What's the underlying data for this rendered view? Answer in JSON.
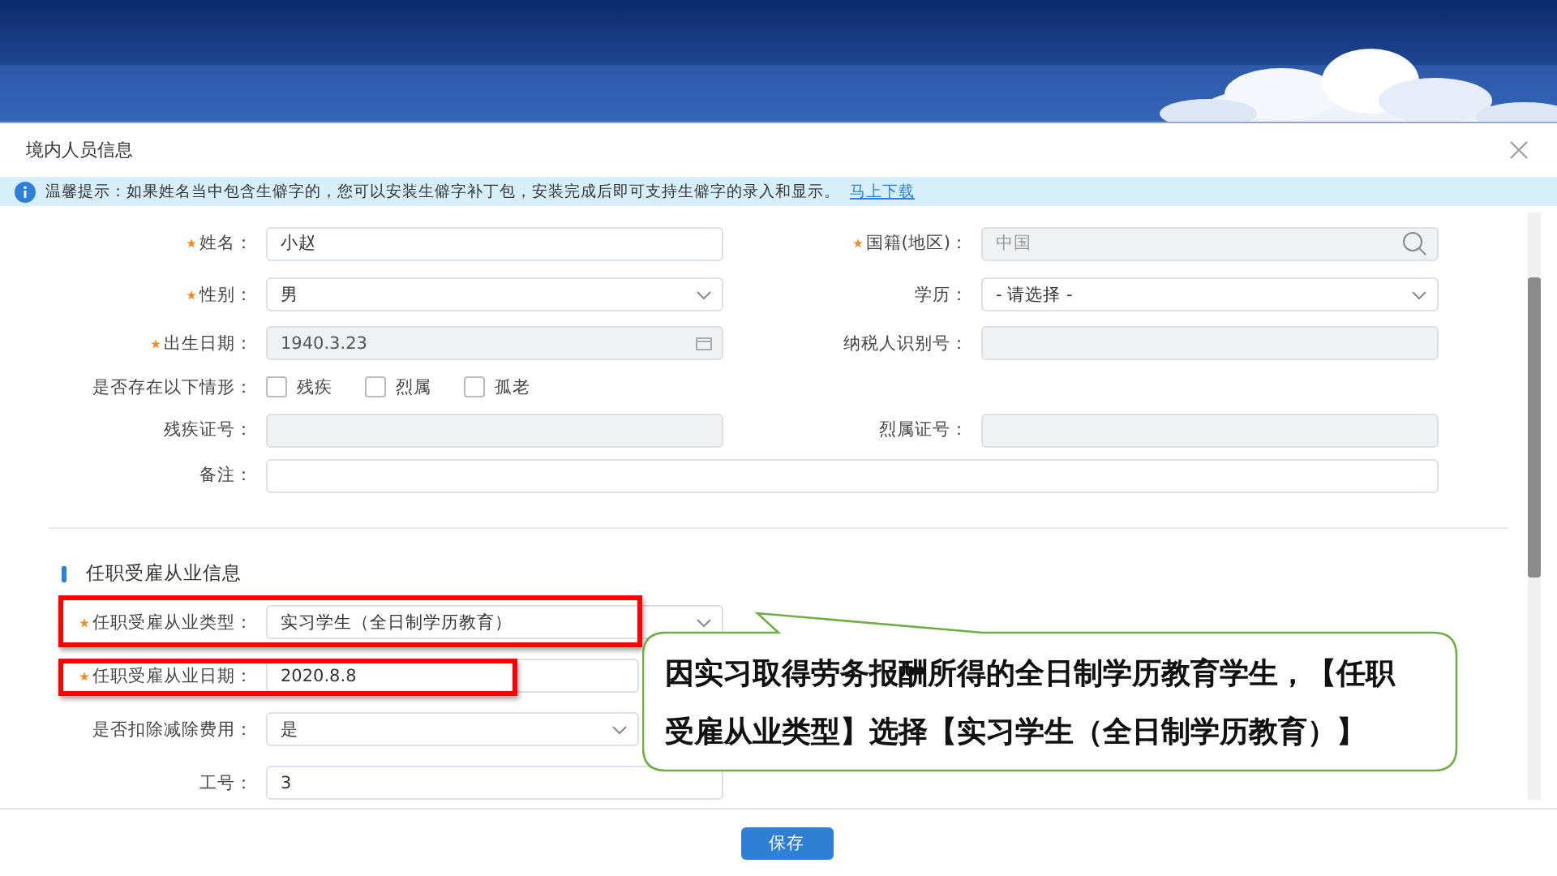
{
  "dialog": {
    "title": "境内人员信息"
  },
  "notice": {
    "text": "温馨提示：如果姓名当中包含生僻字的，您可以安装生僻字补丁包，安装完成后即可支持生僻字的录入和显示。",
    "link": "马上下载"
  },
  "personal_rows": [
    {
      "cells": [
        {
          "label": "姓名：",
          "required": true,
          "kind": "text",
          "value": "小赵",
          "disabled": false
        },
        {
          "label": "国籍(地区)：",
          "required": true,
          "kind": "search",
          "value": "中国",
          "disabled": true
        }
      ]
    },
    {
      "cells": [
        {
          "label": "性别：",
          "required": true,
          "kind": "select",
          "value": "男",
          "disabled": false
        },
        {
          "label": "学历：",
          "required": false,
          "kind": "select",
          "value": "- 请选择 -",
          "disabled": false
        }
      ]
    },
    {
      "cells": [
        {
          "label": "出生日期：",
          "required": true,
          "kind": "date",
          "value": "1940.3.23",
          "disabled": true
        },
        {
          "label": "纳税人识别号：",
          "required": false,
          "kind": "text",
          "disabled": true
        }
      ]
    },
    {
      "cells": [
        {
          "label": "是否存在以下情形：",
          "required": false,
          "kind": "checkboxes",
          "options": [
            {
              "label": "残疾",
              "checked": false
            },
            {
              "label": "烈属",
              "checked": false
            },
            {
              "label": "孤老",
              "checked": false
            }
          ]
        }
      ]
    },
    {
      "cells": [
        {
          "label": "残疾证号：",
          "required": false,
          "kind": "text",
          "disabled": true
        },
        {
          "label": "烈属证号：",
          "required": false,
          "kind": "text",
          "disabled": true
        }
      ]
    },
    {
      "cells": [
        {
          "label": "备注：",
          "required": false,
          "kind": "text",
          "disabled": false,
          "wide": true
        }
      ]
    }
  ],
  "employment": {
    "title": "任职受雇从业信息",
    "rows": [
      {
        "label": "任职受雇从业类型：",
        "required": true,
        "kind": "select",
        "value": "实习学生（全日制学历教育）",
        "disabled": false,
        "highlighted": true
      },
      {
        "label": "任职受雇从业日期：",
        "required": true,
        "kind": "text",
        "value": "2020.8.8",
        "disabled": false,
        "highlighted": true
      },
      {
        "label": "是否扣除减除费用：",
        "required": false,
        "kind": "select",
        "value": "是",
        "disabled": false,
        "highlighted": false
      },
      {
        "label": "工号：",
        "required": false,
        "kind": "text",
        "value": "3",
        "disabled": false,
        "highlighted": false
      }
    ]
  },
  "callout": {
    "text": "因实习取得劳务报酬所得的全日制学历教育学生，【任职受雇从业类型】选择【实习学生（全日制学历教育）】"
  },
  "footer": {
    "save": "保存"
  }
}
